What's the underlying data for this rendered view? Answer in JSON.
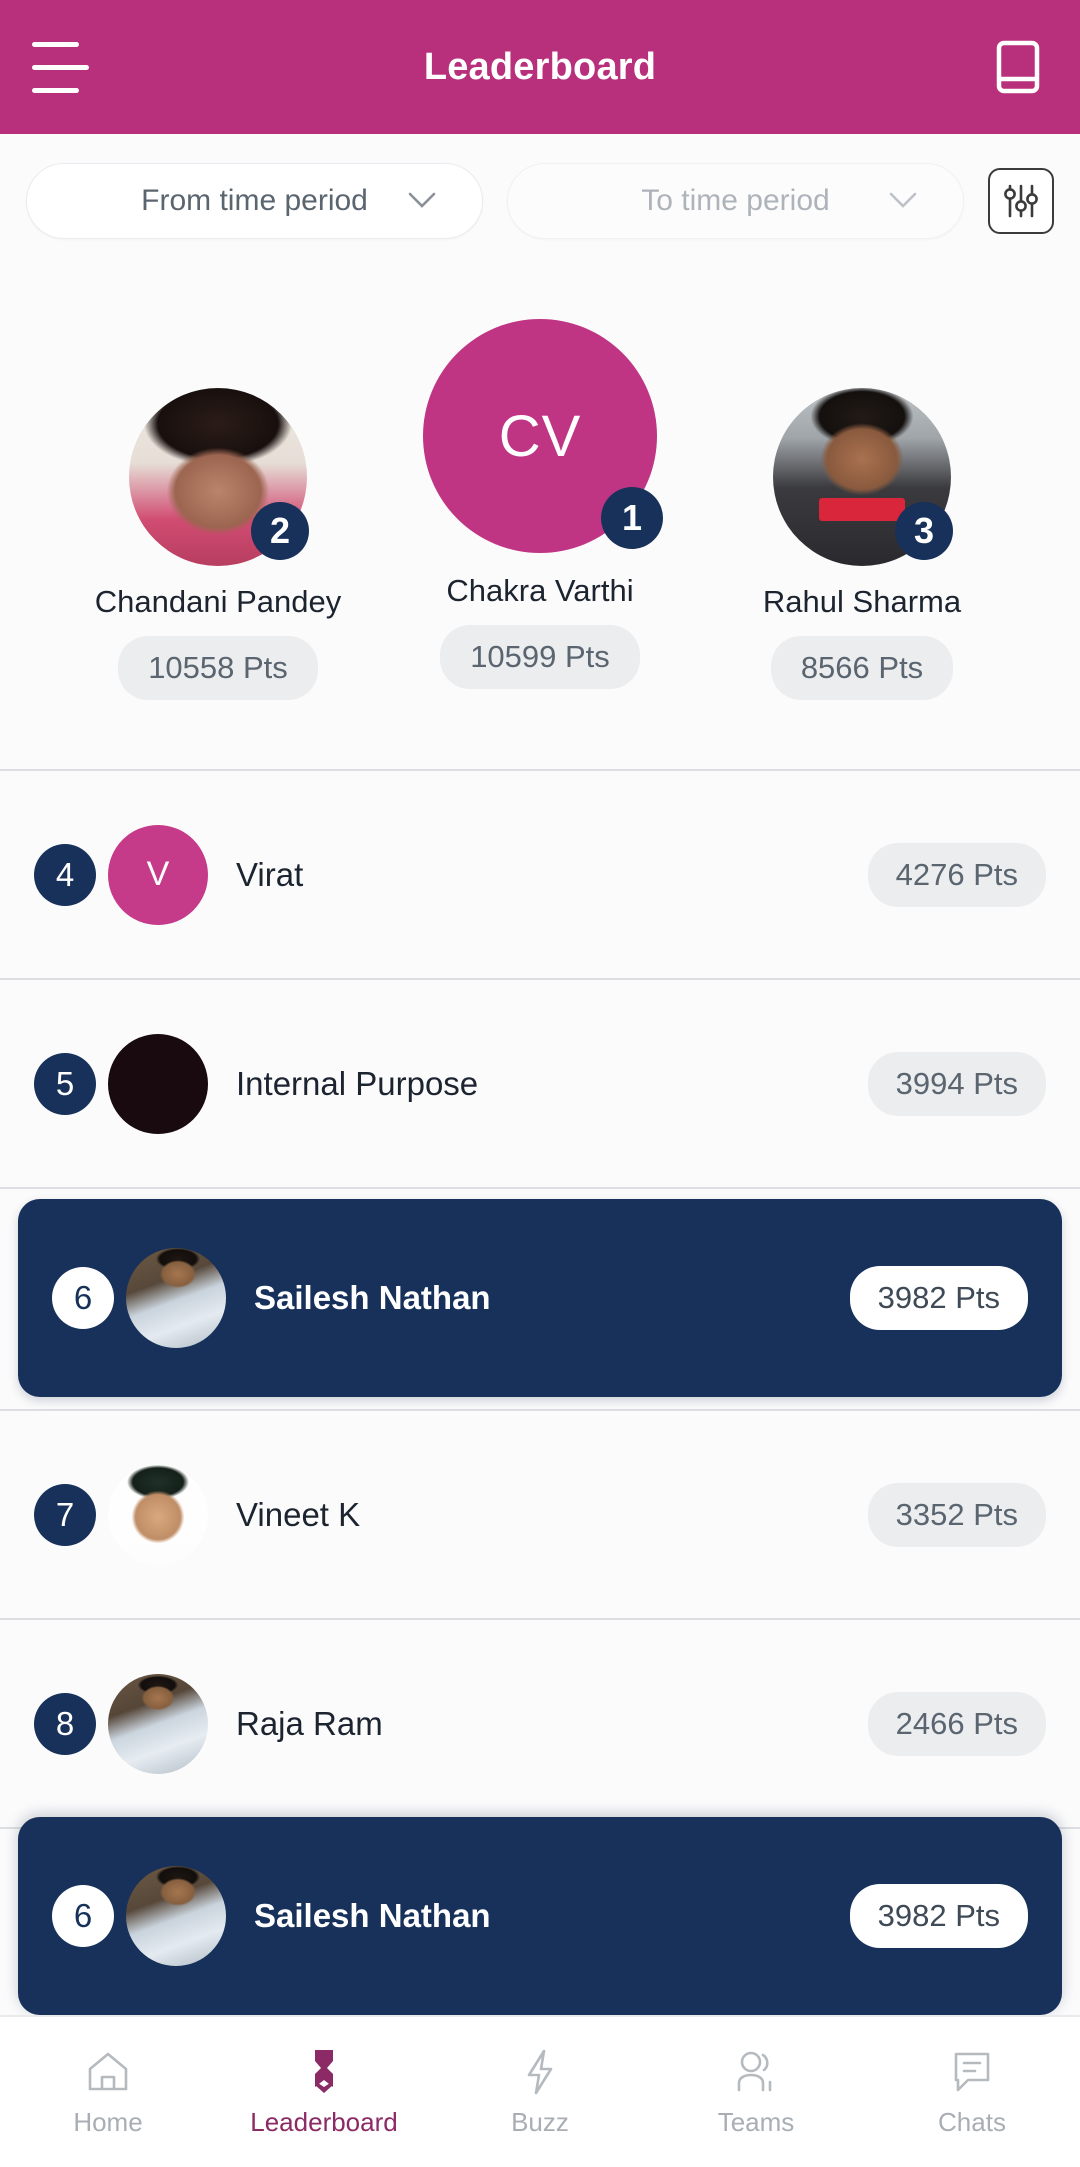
{
  "header": {
    "title": "Leaderboard",
    "menu_icon": "hamburger-menu-icon",
    "action_icon": "book-icon",
    "background_color": "#B82F7C"
  },
  "filters": {
    "from": {
      "value": "From time period",
      "caret_icon": "chevron-down-icon"
    },
    "to": {
      "placeholder": "To time period",
      "caret_icon": "chevron-down-icon"
    },
    "filter_button_icon": "sliders-filter-icon"
  },
  "podium": [
    {
      "rank": "2",
      "name": "Chandani  Pandey",
      "points": "10558 Pts",
      "avatar_type": "photo",
      "initials": ""
    },
    {
      "rank": "1",
      "name": "Chakra Varthi",
      "points": "10599 Pts",
      "avatar_type": "initials",
      "initials": "CV"
    },
    {
      "rank": "3",
      "name": "Rahul Sharma",
      "points": "8566 Pts",
      "avatar_type": "photo",
      "initials": ""
    }
  ],
  "rows": [
    {
      "rank": "4",
      "name": "Virat",
      "points": "4276 Pts",
      "avatar_type": "initials",
      "initials": "V",
      "highlighted": false
    },
    {
      "rank": "5",
      "name": "Internal Purpose",
      "points": "3994 Pts",
      "avatar_type": "solid",
      "initials": "",
      "highlighted": false
    },
    {
      "rank": "6",
      "name": "Sailesh Nathan",
      "points": "3982 Pts",
      "avatar_type": "photo",
      "initials": "",
      "highlighted": true
    },
    {
      "rank": "7",
      "name": "Vineet K",
      "points": "3352 Pts",
      "avatar_type": "photo",
      "initials": "",
      "highlighted": false
    },
    {
      "rank": "8",
      "name": "Raja Ram",
      "points": "2466 Pts",
      "avatar_type": "photo",
      "initials": "",
      "highlighted": false
    }
  ],
  "current_user_row": {
    "rank": "6",
    "name": "Sailesh Nathan",
    "points": "3982 Pts"
  },
  "tabs": [
    {
      "label": "Home",
      "icon": "home-icon",
      "active": false
    },
    {
      "label": "Leaderboard",
      "icon": "medal-icon",
      "active": true
    },
    {
      "label": "Buzz",
      "icon": "lightning-icon",
      "active": false
    },
    {
      "label": "Teams",
      "icon": "people-icon",
      "active": false
    },
    {
      "label": "Chats",
      "icon": "chat-icon",
      "active": false
    }
  ],
  "colors": {
    "brand_pink": "#B82F7C",
    "avatar_pink": "#BF3584",
    "navy": "#17315A",
    "pill_gray": "#ECEDEF",
    "accent_purple": "#8B2A64"
  }
}
